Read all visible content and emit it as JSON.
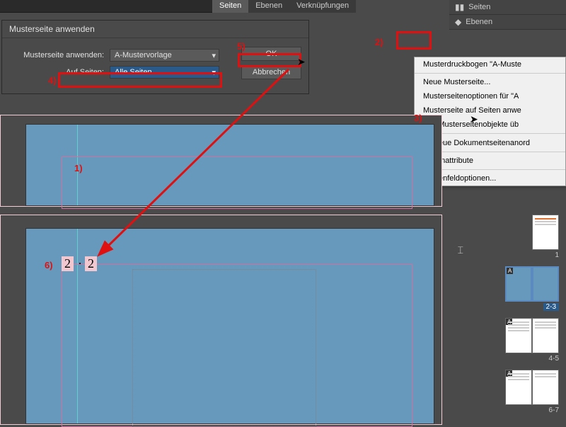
{
  "topTabs": {
    "seiten": "Seiten",
    "ebenen": "Ebenen",
    "verknuepfungen": "Verknüpfungen"
  },
  "rightPanel": {
    "seiten": "Seiten",
    "ebenen": "Ebenen"
  },
  "contextMenu": {
    "item1": "Musterdruckbogen \"A-Muste",
    "item2": "Neue Musterseite...",
    "item3": "Musterseitenoptionen für \"A",
    "item4": "Musterseite auf Seiten anwe",
    "item5": "Alle Musterseitenobjekte üb",
    "item6": "Neue Dokumentseitenanord",
    "item7": "Seitenattribute",
    "item8": "Bedienfeldoptionen..."
  },
  "dialog": {
    "title": "Musterseite anwenden",
    "label1": "Musterseite anwenden:",
    "value1": "A-Mustervorlage",
    "label2": "Auf Seiten:",
    "value2": "Alle Seiten",
    "ok": "OK",
    "cancel": "Abbrechen"
  },
  "pageNumbers": {
    "left": "2",
    "sep": "·",
    "right": "2"
  },
  "spreads": {
    "s1": "1",
    "s2": "2-3",
    "s3": "4-5",
    "s4": "6-7",
    "badge": "A"
  },
  "annotations": {
    "a1": "1)",
    "a2": "2)",
    "a3": "3)",
    "a4": "4)",
    "a5": "5)",
    "a6": "6)"
  }
}
